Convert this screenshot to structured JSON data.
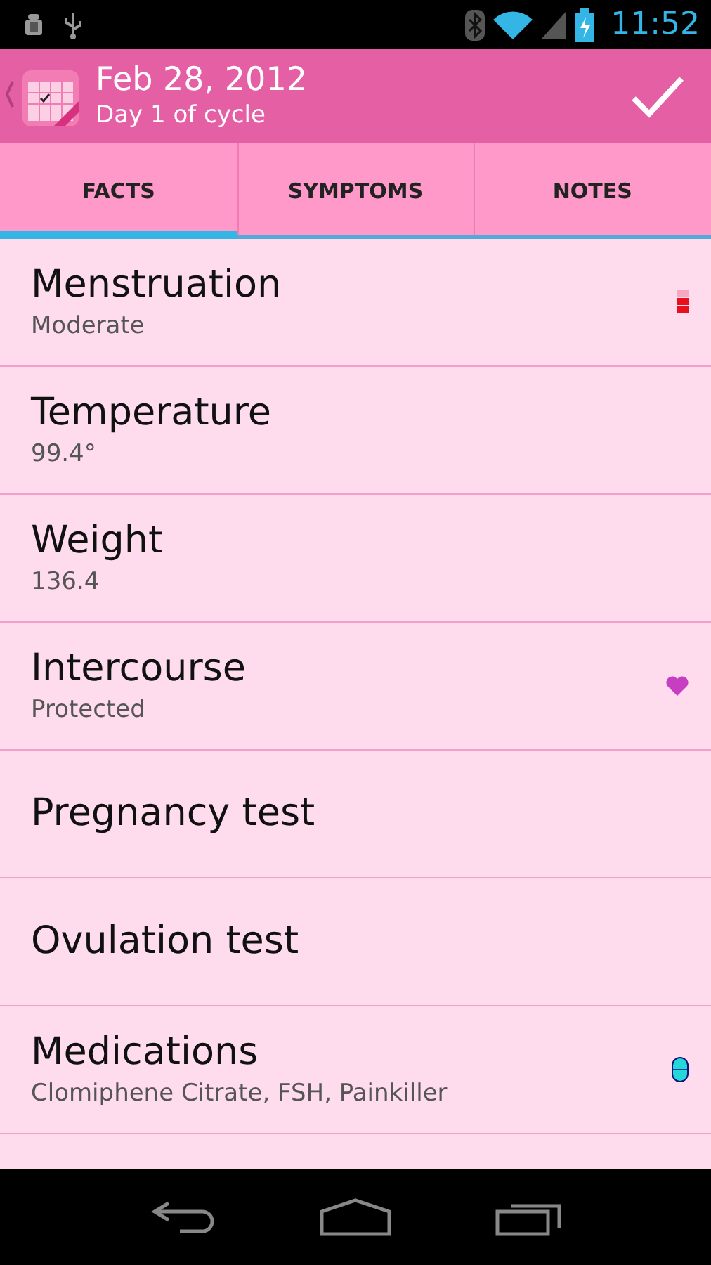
{
  "status_bar": {
    "time": "11:52"
  },
  "action_bar": {
    "title": "Feb 28, 2012",
    "subtitle": "Day 1 of cycle"
  },
  "tabs": [
    {
      "label": "FACTS",
      "selected": true
    },
    {
      "label": "SYMPTOMS",
      "selected": false
    },
    {
      "label": "NOTES",
      "selected": false
    }
  ],
  "rows": [
    {
      "kind": "flow",
      "title": "Menstruation",
      "value": "Moderate"
    },
    {
      "kind": "plain",
      "title": "Temperature",
      "value": "99.4°"
    },
    {
      "kind": "plain",
      "title": "Weight",
      "value": "136.4"
    },
    {
      "kind": "heart",
      "title": "Intercourse",
      "value": "Protected"
    },
    {
      "kind": "plain",
      "title": "Pregnancy test"
    },
    {
      "kind": "plain",
      "title": "Ovulation test"
    },
    {
      "kind": "pill",
      "title": "Medications",
      "value": "Clomiphene Citrate, FSH, Painkiller"
    }
  ]
}
